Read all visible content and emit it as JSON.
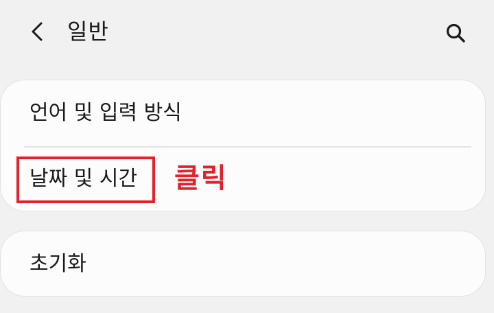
{
  "header": {
    "title": "일반",
    "back_icon": "chevron-left-icon",
    "search_icon": "search-icon"
  },
  "settings": {
    "group1": [
      {
        "label": "언어 및 입력 방식"
      },
      {
        "label": "날짜 및 시간"
      }
    ],
    "group2": [
      {
        "label": "초기화"
      }
    ]
  },
  "annotation": {
    "text": "클릭",
    "color": "#e0232b"
  },
  "colors": {
    "background": "#f1f1f1",
    "card": "#fcfcfc",
    "text": "#1a1a1a"
  }
}
